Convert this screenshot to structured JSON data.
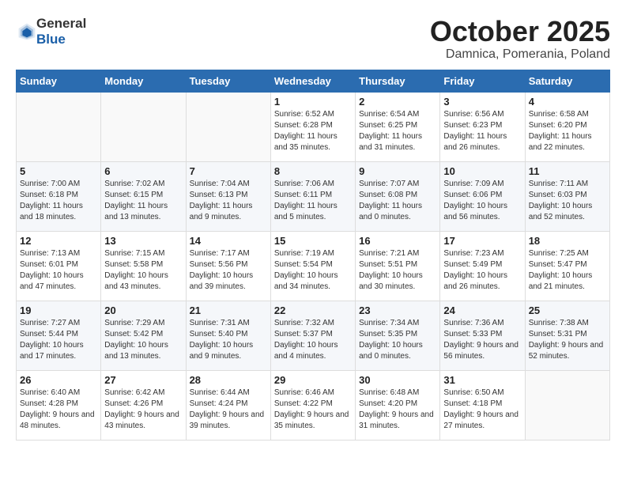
{
  "header": {
    "logo_general": "General",
    "logo_blue": "Blue",
    "month": "October 2025",
    "location": "Damnica, Pomerania, Poland"
  },
  "weekdays": [
    "Sunday",
    "Monday",
    "Tuesday",
    "Wednesday",
    "Thursday",
    "Friday",
    "Saturday"
  ],
  "weeks": [
    [
      {
        "day": "",
        "content": ""
      },
      {
        "day": "",
        "content": ""
      },
      {
        "day": "",
        "content": ""
      },
      {
        "day": "1",
        "content": "Sunrise: 6:52 AM\nSunset: 6:28 PM\nDaylight: 11 hours\nand 35 minutes."
      },
      {
        "day": "2",
        "content": "Sunrise: 6:54 AM\nSunset: 6:25 PM\nDaylight: 11 hours\nand 31 minutes."
      },
      {
        "day": "3",
        "content": "Sunrise: 6:56 AM\nSunset: 6:23 PM\nDaylight: 11 hours\nand 26 minutes."
      },
      {
        "day": "4",
        "content": "Sunrise: 6:58 AM\nSunset: 6:20 PM\nDaylight: 11 hours\nand 22 minutes."
      }
    ],
    [
      {
        "day": "5",
        "content": "Sunrise: 7:00 AM\nSunset: 6:18 PM\nDaylight: 11 hours\nand 18 minutes."
      },
      {
        "day": "6",
        "content": "Sunrise: 7:02 AM\nSunset: 6:15 PM\nDaylight: 11 hours\nand 13 minutes."
      },
      {
        "day": "7",
        "content": "Sunrise: 7:04 AM\nSunset: 6:13 PM\nDaylight: 11 hours\nand 9 minutes."
      },
      {
        "day": "8",
        "content": "Sunrise: 7:06 AM\nSunset: 6:11 PM\nDaylight: 11 hours\nand 5 minutes."
      },
      {
        "day": "9",
        "content": "Sunrise: 7:07 AM\nSunset: 6:08 PM\nDaylight: 11 hours\nand 0 minutes."
      },
      {
        "day": "10",
        "content": "Sunrise: 7:09 AM\nSunset: 6:06 PM\nDaylight: 10 hours\nand 56 minutes."
      },
      {
        "day": "11",
        "content": "Sunrise: 7:11 AM\nSunset: 6:03 PM\nDaylight: 10 hours\nand 52 minutes."
      }
    ],
    [
      {
        "day": "12",
        "content": "Sunrise: 7:13 AM\nSunset: 6:01 PM\nDaylight: 10 hours\nand 47 minutes."
      },
      {
        "day": "13",
        "content": "Sunrise: 7:15 AM\nSunset: 5:58 PM\nDaylight: 10 hours\nand 43 minutes."
      },
      {
        "day": "14",
        "content": "Sunrise: 7:17 AM\nSunset: 5:56 PM\nDaylight: 10 hours\nand 39 minutes."
      },
      {
        "day": "15",
        "content": "Sunrise: 7:19 AM\nSunset: 5:54 PM\nDaylight: 10 hours\nand 34 minutes."
      },
      {
        "day": "16",
        "content": "Sunrise: 7:21 AM\nSunset: 5:51 PM\nDaylight: 10 hours\nand 30 minutes."
      },
      {
        "day": "17",
        "content": "Sunrise: 7:23 AM\nSunset: 5:49 PM\nDaylight: 10 hours\nand 26 minutes."
      },
      {
        "day": "18",
        "content": "Sunrise: 7:25 AM\nSunset: 5:47 PM\nDaylight: 10 hours\nand 21 minutes."
      }
    ],
    [
      {
        "day": "19",
        "content": "Sunrise: 7:27 AM\nSunset: 5:44 PM\nDaylight: 10 hours\nand 17 minutes."
      },
      {
        "day": "20",
        "content": "Sunrise: 7:29 AM\nSunset: 5:42 PM\nDaylight: 10 hours\nand 13 minutes."
      },
      {
        "day": "21",
        "content": "Sunrise: 7:31 AM\nSunset: 5:40 PM\nDaylight: 10 hours\nand 9 minutes."
      },
      {
        "day": "22",
        "content": "Sunrise: 7:32 AM\nSunset: 5:37 PM\nDaylight: 10 hours\nand 4 minutes."
      },
      {
        "day": "23",
        "content": "Sunrise: 7:34 AM\nSunset: 5:35 PM\nDaylight: 10 hours\nand 0 minutes."
      },
      {
        "day": "24",
        "content": "Sunrise: 7:36 AM\nSunset: 5:33 PM\nDaylight: 9 hours\nand 56 minutes."
      },
      {
        "day": "25",
        "content": "Sunrise: 7:38 AM\nSunset: 5:31 PM\nDaylight: 9 hours\nand 52 minutes."
      }
    ],
    [
      {
        "day": "26",
        "content": "Sunrise: 6:40 AM\nSunset: 4:28 PM\nDaylight: 9 hours\nand 48 minutes."
      },
      {
        "day": "27",
        "content": "Sunrise: 6:42 AM\nSunset: 4:26 PM\nDaylight: 9 hours\nand 43 minutes."
      },
      {
        "day": "28",
        "content": "Sunrise: 6:44 AM\nSunset: 4:24 PM\nDaylight: 9 hours\nand 39 minutes."
      },
      {
        "day": "29",
        "content": "Sunrise: 6:46 AM\nSunset: 4:22 PM\nDaylight: 9 hours\nand 35 minutes."
      },
      {
        "day": "30",
        "content": "Sunrise: 6:48 AM\nSunset: 4:20 PM\nDaylight: 9 hours\nand 31 minutes."
      },
      {
        "day": "31",
        "content": "Sunrise: 6:50 AM\nSunset: 4:18 PM\nDaylight: 9 hours\nand 27 minutes."
      },
      {
        "day": "",
        "content": ""
      }
    ]
  ]
}
